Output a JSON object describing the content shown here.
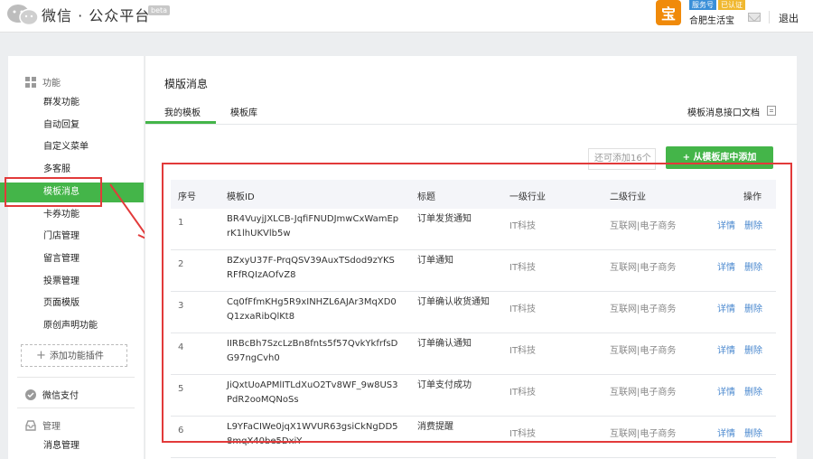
{
  "header": {
    "brand": "微信 · 公众平台",
    "beta": "beta",
    "avatar_char": "宝",
    "badge_service": "服务号",
    "badge_verified": "已认证",
    "account_name": "合肥生活宝",
    "logout": "退出"
  },
  "sidebar": {
    "section_function": "功能",
    "items": [
      {
        "label": "群发功能"
      },
      {
        "label": "自动回复"
      },
      {
        "label": "自定义菜单"
      },
      {
        "label": "多客服"
      },
      {
        "label": "模板消息"
      },
      {
        "label": "卡券功能"
      },
      {
        "label": "门店管理"
      },
      {
        "label": "留言管理"
      },
      {
        "label": "投票管理"
      },
      {
        "label": "页面模版"
      },
      {
        "label": "原创声明功能"
      }
    ],
    "add_plugin": "添加功能插件",
    "section_pay": "微信支付",
    "section_manage": "管理",
    "manage_items": [
      {
        "label": "消息管理"
      }
    ]
  },
  "main": {
    "title": "模版消息",
    "tabs": [
      {
        "label": "我的模板"
      },
      {
        "label": "模板库"
      }
    ],
    "doc_link": "模板消息接口文档",
    "remaining": "还可添加16个",
    "add_button": "+ 从模板库中添加",
    "columns": [
      "序号",
      "模板ID",
      "标题",
      "一级行业",
      "二级行业",
      "操作"
    ],
    "rows": [
      {
        "seq": "1",
        "id": "BR4VuyjJXLCB-JqfiFNUDJmwCxWamEprK1lhUKVlb5w",
        "title": "订单发货通知",
        "ind1": "IT科技",
        "ind2": "互联网|电子商务",
        "detail": "详情",
        "del": "删除"
      },
      {
        "seq": "2",
        "id": "BZxyU37F-PrqQSV39AuxTSdod9zYKSRFfRQIzAOfvZ8",
        "title": "订单通知",
        "ind1": "IT科技",
        "ind2": "互联网|电子商务",
        "detail": "详情",
        "del": "删除"
      },
      {
        "seq": "3",
        "id": "Cq0fFfmKHg5R9xINHZL6AJAr3MqXD0Q1zxaRibQlKt8",
        "title": "订单确认收货通知",
        "ind1": "IT科技",
        "ind2": "互联网|电子商务",
        "detail": "详情",
        "del": "删除"
      },
      {
        "seq": "4",
        "id": "IIRBcBh7SzcLzBn8fnts5f57QvkYkfrfsDG97ngCvh0",
        "title": "订单确认通知",
        "ind1": "IT科技",
        "ind2": "互联网|电子商务",
        "detail": "详情",
        "del": "删除"
      },
      {
        "seq": "5",
        "id": "JiQxtUoAPMlITLdXuO2Tv8WF_9w8US3PdR2ooMQNoSs",
        "title": "订单支付成功",
        "ind1": "IT科技",
        "ind2": "互联网|电子商务",
        "detail": "详情",
        "del": "删除"
      },
      {
        "seq": "6",
        "id": "L9YFaCIWe0jqX1WVUR63gsiCkNgDD58mqX40be5DxiY",
        "title": "消费提醒",
        "ind1": "IT科技",
        "ind2": "互联网|电子商务",
        "detail": "详情",
        "del": "删除"
      }
    ]
  },
  "colors": {
    "accent": "#44b549",
    "link": "#4a88cf",
    "annotation": "#e23a3a"
  }
}
